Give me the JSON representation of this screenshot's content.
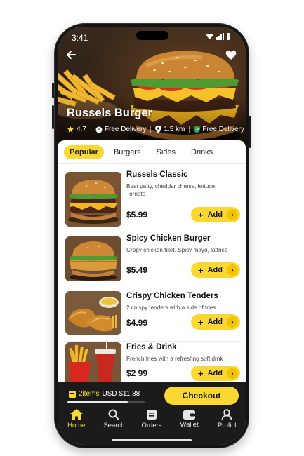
{
  "status_bar": {
    "time": "3:41"
  },
  "restaurant": {
    "name": "Russels Burger",
    "rating": "4.7",
    "delivery_label": "Free Delivery",
    "distance": "1.5 km",
    "delivery_badge": "Free Delivery"
  },
  "tabs": [
    {
      "label": "Popular",
      "active": true
    },
    {
      "label": "Burgers",
      "active": false
    },
    {
      "label": "Sides",
      "active": false
    },
    {
      "label": "Drinks",
      "active": false
    }
  ],
  "menu_items": [
    {
      "name": "Russels Classic",
      "description": "Beat  patty, cheddar chrese, lettuce. Tornato",
      "price": "$5.99",
      "add_label": "Add",
      "image_icon": "burger-photo"
    },
    {
      "name": "Spicy Chicken Burger",
      "description": "Crbpy chicken fillet. Spicy mayo, lattnce",
      "price": "$5.49",
      "add_label": "Add",
      "image_icon": "chicken-burger-photo"
    },
    {
      "name": "Crispy Chicken Tenders",
      "description": "2 cnispy tenders with a side of fries",
      "price": "$4.99",
      "add_label": "Add",
      "image_icon": "chicken-tenders-photo"
    },
    {
      "name": "Fries & Drink",
      "description": "French fnes with a refreshng soft drnk",
      "price": "$2 99",
      "add_label": "Add",
      "image_icon": "fries-drink-photo"
    }
  ],
  "cart": {
    "items_count": "2items",
    "total": "USD $11.88",
    "progress": 0.78,
    "checkout_label": "Checkout"
  },
  "nav": [
    {
      "label": "Home",
      "icon": "home-icon",
      "active": true
    },
    {
      "label": "Search",
      "icon": "search-icon",
      "active": false
    },
    {
      "label": "Orders",
      "icon": "orders-icon",
      "active": false
    },
    {
      "label": "Wallet",
      "icon": "wallet-icon",
      "active": false
    },
    {
      "label": "Proficl",
      "icon": "profile-icon",
      "active": false
    }
  ],
  "colors": {
    "accent": "#f9d833",
    "dark": "#1b1b1b"
  }
}
